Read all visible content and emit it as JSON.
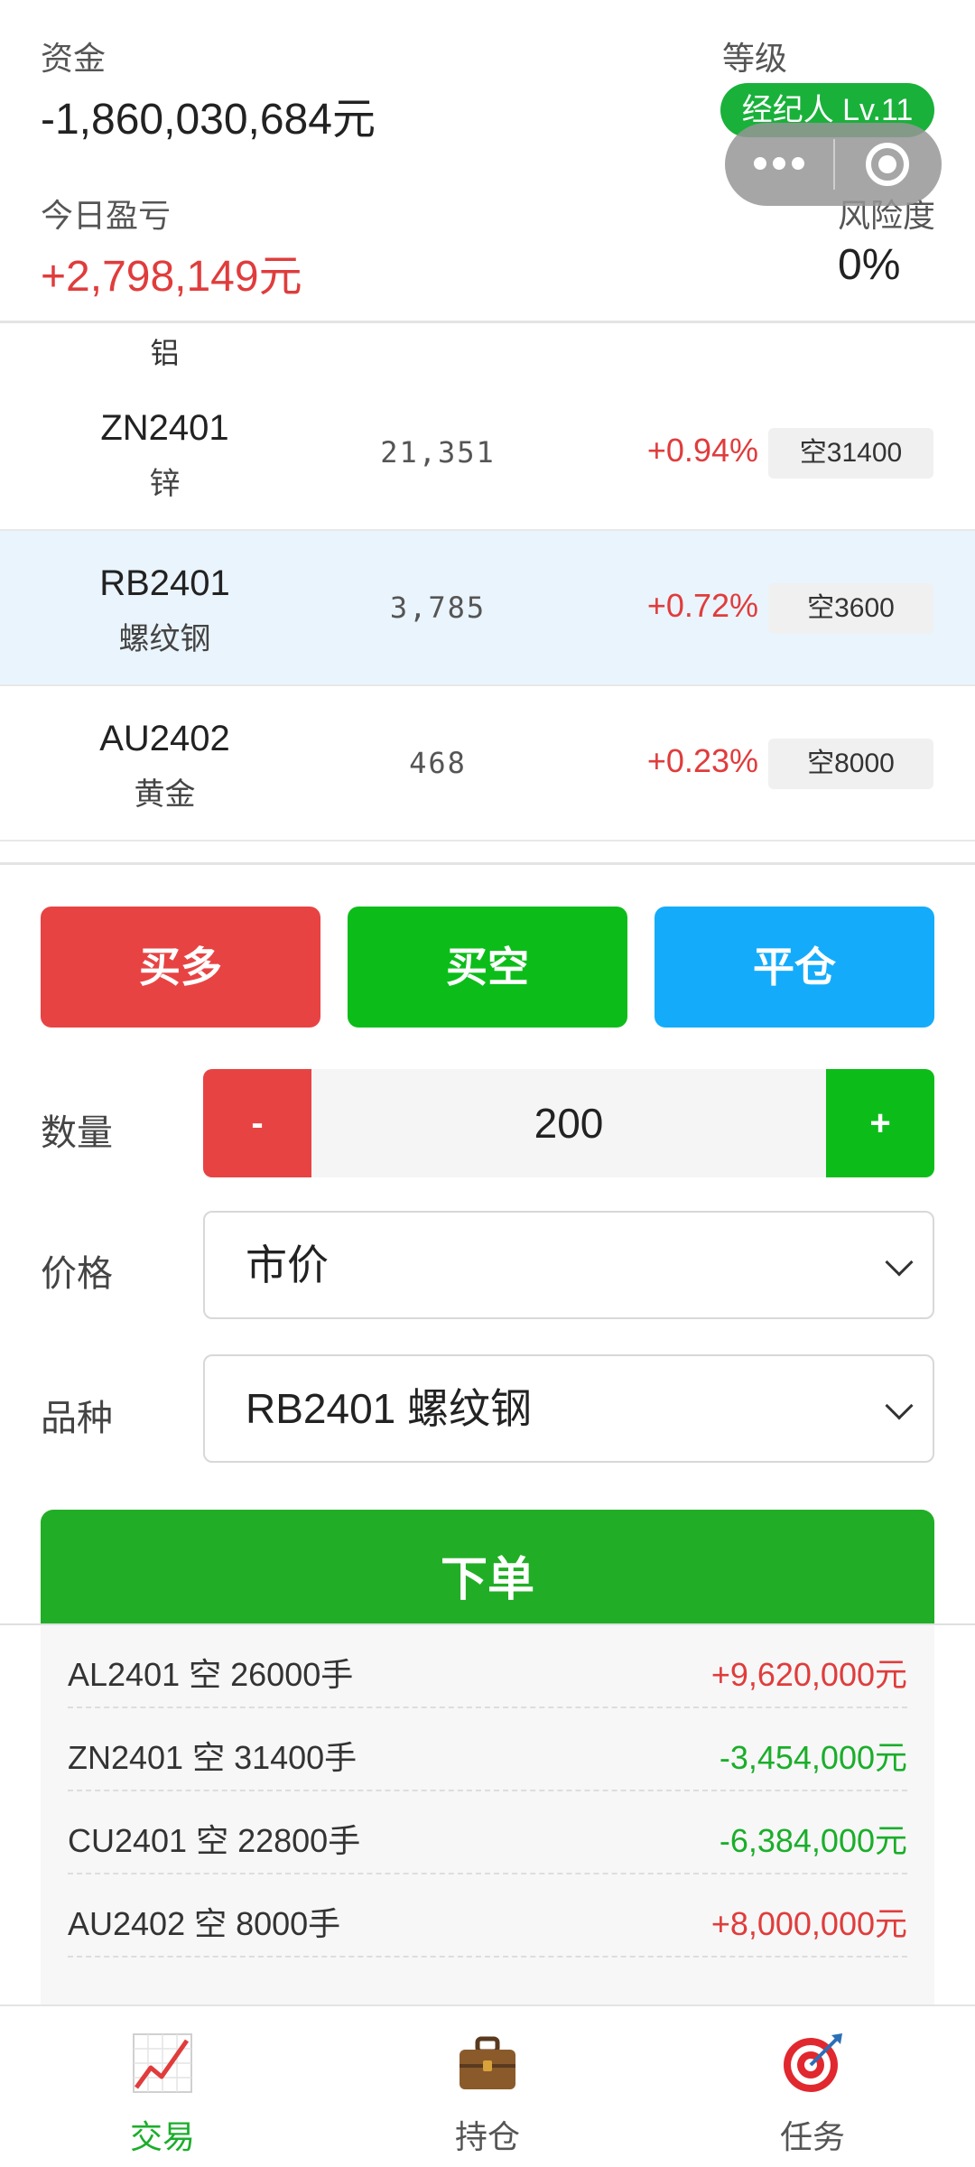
{
  "header": {
    "funds_label": "资金",
    "funds_value": "-1,860,030,684元",
    "level_label": "等级",
    "level_badge": "经纪人 Lv.11",
    "pnl_label": "今日盈亏",
    "pnl_value": "+2,798,149元",
    "risk_label": "风险度",
    "risk_value": "0%"
  },
  "capsule": {
    "more_icon": "more-dots-icon",
    "close_icon": "close-circle-icon"
  },
  "quotes": {
    "partial_name": "铝",
    "rows": [
      {
        "code": "ZN2401",
        "name": "锌",
        "price": "21,351",
        "change": "+0.94%",
        "position": "空31400"
      },
      {
        "code": "RB2401",
        "name": "螺纹钢",
        "price": "3,785",
        "change": "+0.72%",
        "position": "空3600"
      },
      {
        "code": "AU2402",
        "name": "黄金",
        "price": "468",
        "change": "+0.23%",
        "position": "空8000"
      }
    ]
  },
  "actions": {
    "buy_long": "买多",
    "buy_short": "买空",
    "close": "平仓"
  },
  "form": {
    "qty_label": "数量",
    "qty_minus": "-",
    "qty_value": "200",
    "qty_plus": "+",
    "price_label": "价格",
    "price_selected": "市价",
    "symbol_label": "品种",
    "symbol_selected": "RB2401 螺纹钢",
    "submit": "下单"
  },
  "positions": [
    {
      "desc": "AL2401 空 26000手",
      "pnl": "+9,620,000元",
      "sign": "pos"
    },
    {
      "desc": "ZN2401 空 31400手",
      "pnl": "-3,454,000元",
      "sign": "neg"
    },
    {
      "desc": "CU2401 空 22800手",
      "pnl": "-6,384,000元",
      "sign": "neg"
    },
    {
      "desc": "AU2402 空 8000手",
      "pnl": "+8,000,000元",
      "sign": "pos"
    }
  ],
  "tabs": [
    {
      "label": "交易",
      "icon": "chart-up-icon",
      "active": true
    },
    {
      "label": "持仓",
      "icon": "briefcase-icon",
      "active": false
    },
    {
      "label": "任务",
      "icon": "target-icon",
      "active": false
    }
  ],
  "colors": {
    "red": "#e84343",
    "green": "#0cbd1a",
    "blue": "#14acfa",
    "submit": "#21ae26"
  }
}
